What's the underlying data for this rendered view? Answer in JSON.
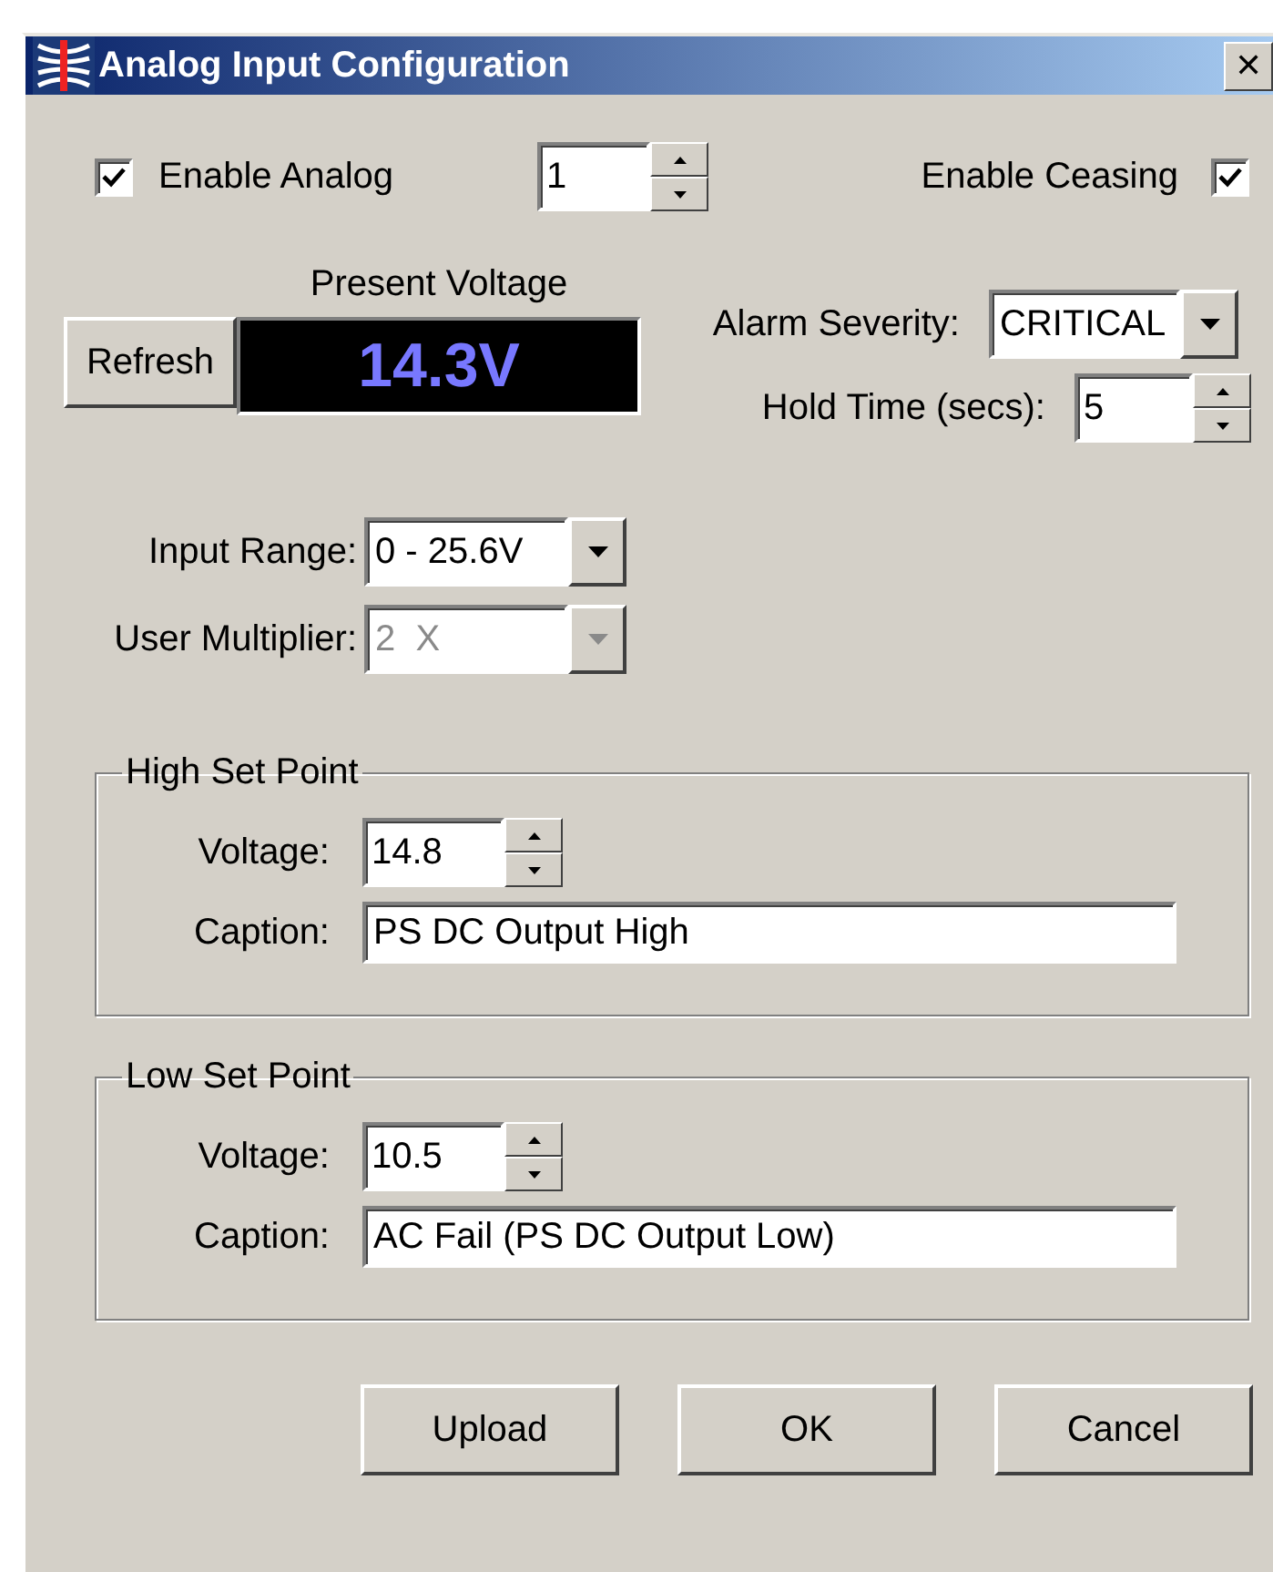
{
  "window": {
    "title": "Analog Input Configuration",
    "close": "✕"
  },
  "enable_analog": {
    "label": "Enable Analog",
    "checked": true
  },
  "channel": {
    "value": "1"
  },
  "enable_ceasing": {
    "label": "Enable Ceasing",
    "checked": true
  },
  "present_voltage": {
    "label": "Present Voltage",
    "reading": "14.3V"
  },
  "refresh_button": "Refresh",
  "alarm_severity": {
    "label": "Alarm Severity:",
    "value": "CRITICAL"
  },
  "hold_time": {
    "label": "Hold Time (secs):",
    "value": "5"
  },
  "input_range": {
    "label": "Input Range:",
    "value": "0 - 25.6V",
    "disabled": false
  },
  "user_multiplier": {
    "label": "User Multiplier:",
    "value": "2  X",
    "disabled": true
  },
  "set_points": [
    {
      "title": "High Set Point",
      "voltage_label": "Voltage:",
      "voltage": "14.8",
      "caption_label": "Caption:",
      "caption": "PS DC Output High"
    },
    {
      "title": "Low Set Point",
      "voltage_label": "Voltage:",
      "voltage": "10.5",
      "caption_label": "Caption:",
      "caption": "AC Fail (PS DC Output Low)"
    }
  ],
  "buttons": [
    "Upload",
    "OK",
    "Cancel"
  ]
}
